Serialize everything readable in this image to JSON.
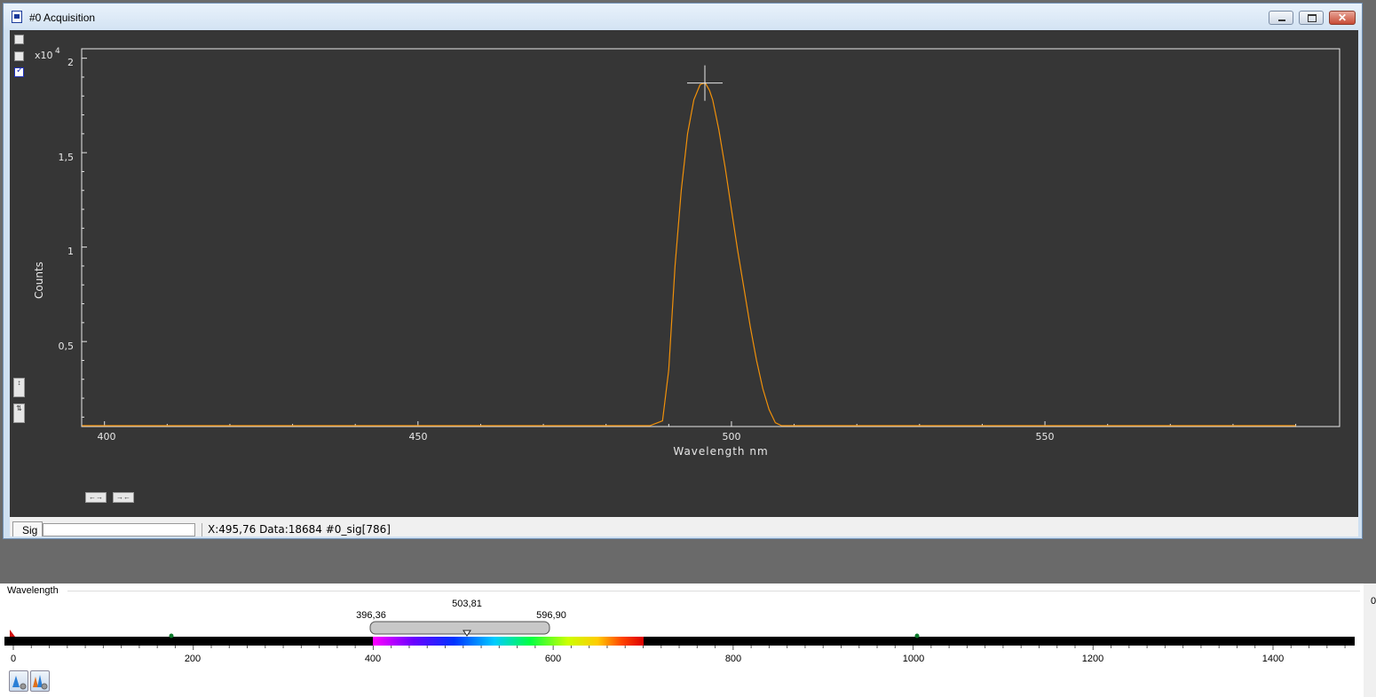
{
  "window": {
    "title": "#0  Acquisition"
  },
  "plot": {
    "exponent_label": "x10",
    "exponent_power": "4",
    "y_axis_label": "Counts",
    "x_axis_label": "Wavelength nm",
    "y_ticks": [
      "2",
      "1,5",
      "1",
      "0,5"
    ],
    "x_ticks": [
      "400",
      "450",
      "500",
      "550"
    ],
    "line_color": "#f0900a",
    "background_color": "#363636"
  },
  "chart_data": {
    "type": "line",
    "x": [
      396.4,
      420,
      450,
      480,
      487,
      489,
      490,
      491,
      492,
      493,
      494,
      495,
      495.8,
      496.5,
      497,
      498,
      499,
      500,
      501,
      502,
      503,
      504,
      505,
      506,
      507,
      508,
      510,
      520,
      550,
      580,
      590
    ],
    "values": [
      0.0,
      0.0,
      0.0,
      0.0,
      0.0,
      0.08,
      0.35,
      0.9,
      1.3,
      1.6,
      1.78,
      1.86,
      1.87,
      1.83,
      1.78,
      1.62,
      1.42,
      1.2,
      0.98,
      0.78,
      0.58,
      0.4,
      0.25,
      0.14,
      0.07,
      0.03,
      0.005,
      0.0,
      0.0,
      0.0,
      0.0
    ],
    "xlabel": "Wavelength nm",
    "ylabel": "Counts",
    "y_multiplier": "x10^4",
    "xlim": [
      396.36,
      597
    ],
    "ylim": [
      0.05,
      2.05
    ],
    "cursor": {
      "x": 495.76,
      "y": 1.8684
    }
  },
  "controls": {
    "zoom_x_out": "←→",
    "zoom_x_in": "→←"
  },
  "statusbar": {
    "tab_label": "Sig",
    "readout": "X:495,76   Data:18684    #0_sig[786]"
  },
  "wavelength_panel": {
    "label": "Wavelength",
    "range_min": "396,36",
    "range_center": "503,81",
    "range_max": "596,90",
    "scale_ticks": [
      "0",
      "200",
      "400",
      "600",
      "800",
      "1000",
      "1200",
      "1400"
    ],
    "right_value": "0"
  },
  "colors": {
    "window_frame": "#cfe0f1",
    "plot_line": "#f0900a"
  }
}
